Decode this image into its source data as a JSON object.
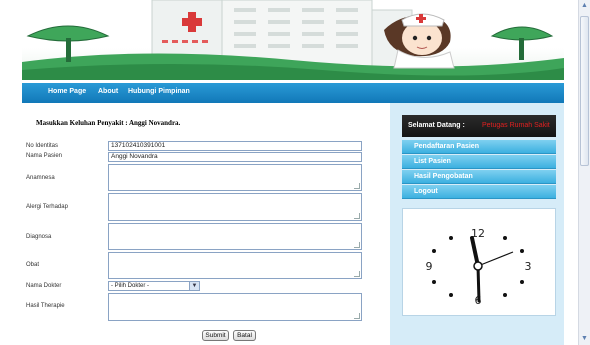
{
  "nav": {
    "items": [
      "Home Page",
      "About",
      "Hubungi Pimpinan"
    ]
  },
  "form": {
    "title": "Masukkan Keluhan Penyakit : Anggi Novandra.",
    "labels": {
      "no_identitas": "No Identitas",
      "nama_pasien": "Nama Pasien",
      "anamnesa": "Anamnesa",
      "alergi": "Alergi Terhadap",
      "diagnosa": "Diagnosa",
      "obat": "Obat",
      "nama_dokter": "Nama Dokter",
      "hasil_therapie": "Hasil Therapie"
    },
    "values": {
      "no_identitas": "137102410391001",
      "nama_pasien": "Anggi Novandra",
      "nama_dokter": "- Pilih Dokter -"
    },
    "submit_label": "Submit",
    "batal_label": "Batal"
  },
  "sidebar": {
    "welcome_label": "Selamat Datang :",
    "welcome_name": "Petugas Rumah Sakit",
    "menu": [
      "Pendaftaran Pasien",
      "List Pasien",
      "Hasil Pengobatan",
      "Logout"
    ]
  },
  "clock": {
    "numerals": [
      "12",
      "3",
      "6",
      "9"
    ]
  },
  "colors": {
    "nav_blue": "#1a88c8",
    "menu_blue": "#4cbbe6",
    "sidebar_bg": "#d6ecf8",
    "welcome_name_red": "#e02020"
  }
}
